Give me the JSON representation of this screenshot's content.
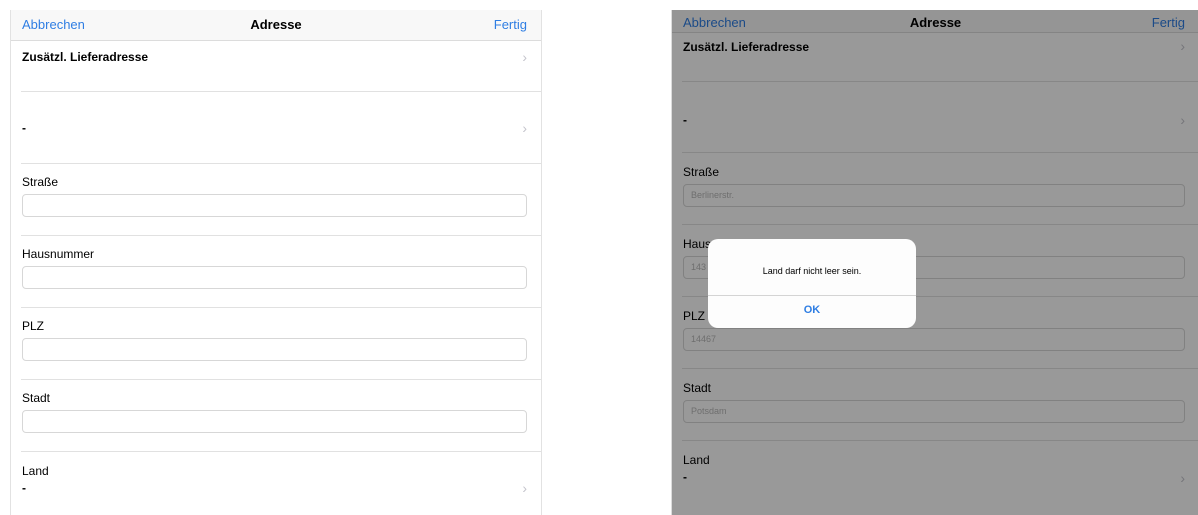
{
  "left": {
    "nav": {
      "cancel": "Abbrechen",
      "title": "Adresse",
      "done": "Fertig"
    },
    "rows": {
      "delivery": "Zusätzl. Lieferadresse",
      "select_value": "-",
      "street_label": "Straße",
      "street_value": "",
      "number_label": "Hausnummer",
      "number_value": "",
      "zip_label": "PLZ",
      "zip_value": "",
      "city_label": "Stadt",
      "city_value": "",
      "country_label": "Land",
      "country_value": "-"
    }
  },
  "right": {
    "nav": {
      "cancel": "Abbrechen",
      "title": "Adresse",
      "done": "Fertig"
    },
    "rows": {
      "delivery": "Zusätzl. Lieferadresse",
      "select_value": "-",
      "street_label": "Straße",
      "street_value": "Berlinerstr.",
      "number_label": "Hausnummer",
      "number_value": "143",
      "zip_label": "PLZ",
      "zip_value": "14467",
      "city_label": "Stadt",
      "city_value": "Potsdam",
      "country_label": "Land",
      "country_value": "-"
    },
    "alert": {
      "message": "Land darf nicht leer sein.",
      "ok": "OK"
    }
  },
  "colors": {
    "accent": "#2f7ee3",
    "separator": "#e1e1e1",
    "overlay": "rgba(0,0,0,0.40)"
  },
  "icons": {
    "chevron": "chevron-right-icon"
  }
}
